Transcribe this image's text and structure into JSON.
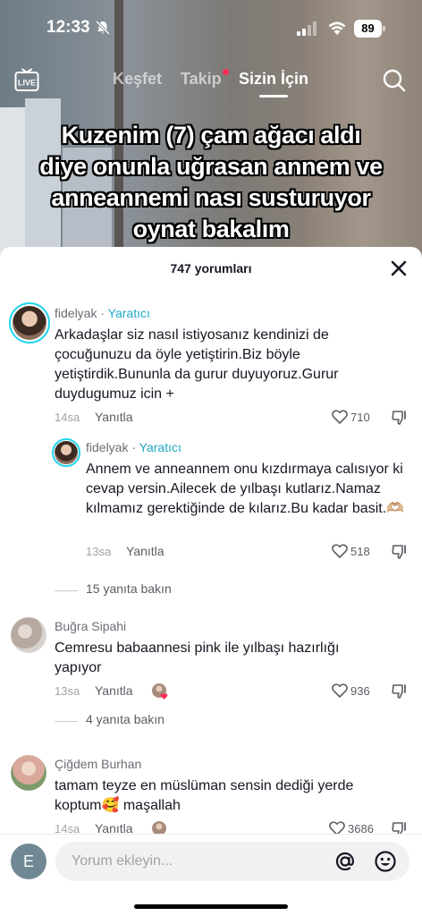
{
  "status_bar": {
    "time": "12:33",
    "battery": "89"
  },
  "nav": {
    "live_label": "LIVE",
    "tabs": [
      {
        "label": "Keşfet"
      },
      {
        "label": "Takip"
      },
      {
        "label": "Sizin İçin"
      }
    ]
  },
  "video": {
    "caption": "Kuzenim (7) çam ağacı aldı diye onunla uğrasan annem ve anneannemi nası susturuyor oynat bakalım"
  },
  "comments_sheet": {
    "count_label": "747 yorumları",
    "comments": [
      {
        "author": "fidelyak",
        "creator_tag": "Yaratıcı",
        "text": "Arkadaşlar siz nasıl istiyosanız kendinizi de çocuğunuzu da öyle yetiştirin.Biz böyle yetiştirdik.Bununla da gurur duyuyoruz.Gurur duydugumuz icin +",
        "time": "14sa",
        "reply_label": "Yanıtla",
        "likes": "710"
      },
      {
        "author": "fidelyak",
        "creator_tag": "Yaratıcı",
        "text": "Annem ve anneannem onu kızdırmaya calısıyor ki cevap versin.Ailecek de yılbaşı kutlarız.Namaz kılmamız gerektiğinde de kılarız.Bu kadar basit.🫶🏼",
        "time": "13sa",
        "reply_label": "Yanıtla",
        "likes": "518",
        "view_replies": "15 yanıta bakın"
      },
      {
        "author": "Buğra Sipahi",
        "text": "Cemresu babaannesi pink ile yılbaşı hazırlığı yapıyor",
        "time": "13sa",
        "reply_label": "Yanıtla",
        "likes": "936",
        "view_replies": "4 yanıta bakın"
      },
      {
        "author": "Çiğdem Burhan",
        "text": "tamam teyze en müslüman sensin dediği yerde koptum🥰 maşallah",
        "time": "14sa",
        "reply_label": "Yanıtla",
        "likes": "3686"
      }
    ]
  },
  "input_bar": {
    "user_initial": "E",
    "placeholder": "Yorum ekleyin..."
  },
  "colors": {
    "accent_cyan": "#20d5ec",
    "notification_red": "#fe2c55",
    "text_primary": "#161823"
  }
}
